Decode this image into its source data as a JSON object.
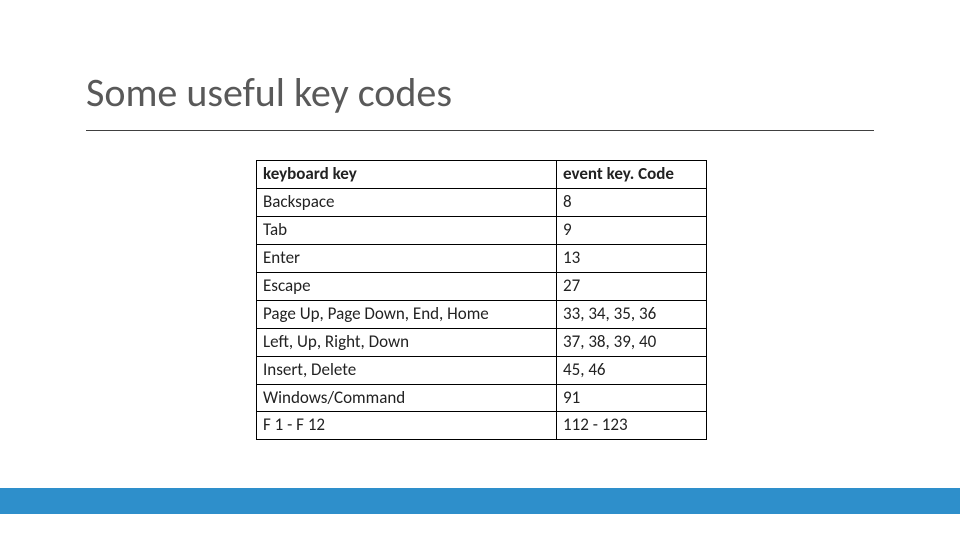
{
  "title": "Some useful key codes",
  "table": {
    "headers": {
      "key": "keyboard key",
      "code": "event key. Code"
    },
    "rows": [
      {
        "key": "Backspace",
        "code": "8"
      },
      {
        "key": "Tab",
        "code": "9"
      },
      {
        "key": "Enter",
        "code": "13"
      },
      {
        "key": "Escape",
        "code": "27"
      },
      {
        "key": "Page Up, Page Down, End, Home",
        "code": "33, 34, 35, 36"
      },
      {
        "key": "Left, Up, Right, Down",
        "code": "37, 38, 39, 40"
      },
      {
        "key": "Insert, Delete",
        "code": "45, 46"
      },
      {
        "key": "Windows/Command",
        "code": "91"
      },
      {
        "key": "F 1 - F 12",
        "code": "112 - 123"
      }
    ]
  }
}
